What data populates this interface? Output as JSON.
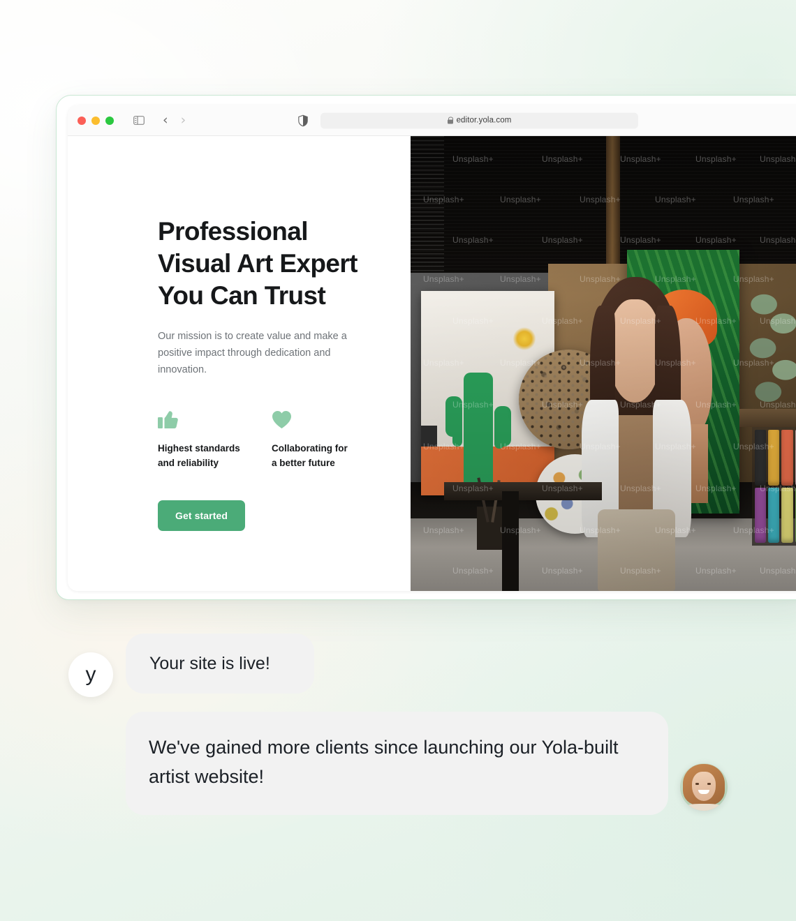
{
  "browser": {
    "traffic_lights": [
      "red",
      "yellow",
      "green"
    ],
    "sidebar_icon": "sidebar-toggle-icon",
    "back_icon": "‹",
    "forward_icon": "›",
    "shield_icon": "privacy-shield-icon",
    "url": "editor.yola.com",
    "reload_icon": "↻"
  },
  "hero": {
    "headline": "Professional\nVisual Art Expert\nYou Can Trust",
    "subcopy": "Our mission is to create value and make a positive impact through dedication and innovation.",
    "features": [
      {
        "icon": "thumbs-up-icon",
        "label": "Highest standards\nand reliability"
      },
      {
        "icon": "heart-icon",
        "label": "Collaborating for\na better future"
      }
    ],
    "cta_label": "Get started",
    "image_alt": "Woman artist seated in an art studio surrounded by paintings, a stone mosaic, a floral plate and paint bottles",
    "image_watermark": "Unsplash+"
  },
  "chat": {
    "yola_logo_letter": "y",
    "messages": [
      {
        "from": "yola",
        "text": "Your site is live!"
      },
      {
        "from": "customer",
        "text": "We've gained more clients since launching our Yola-built artist website!"
      }
    ]
  },
  "colors": {
    "brand_green": "#4bab78",
    "icon_green": "#8ecca8",
    "bubble_grey": "#f2f2f2",
    "text_dark": "#16181a",
    "text_muted": "#6e7378",
    "page_bg_mint": "#e2f1e8",
    "window_border": "#c9e8d4"
  }
}
